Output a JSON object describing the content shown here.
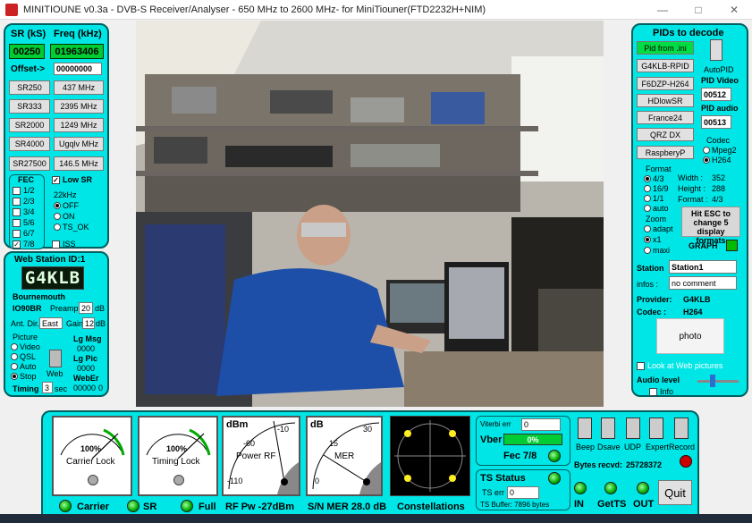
{
  "window": {
    "title": "MINITIOUNE v0.3a - DVB-S Receiver/Analyser - 650 MHz to 2600 MHz- for MiniTiouner(FTD2232H+NIM)",
    "min": "—",
    "max": "□",
    "close": "✕"
  },
  "left": {
    "sr_label": "SR (kS)",
    "freq_label": "Freq (kHz)",
    "sr_value": "00250",
    "freq_value": "01963406",
    "offset_label": "Offset->",
    "offset_value": "00000000",
    "sr_buttons": [
      "SR250",
      "SR333",
      "SR2000",
      "SR4000",
      "SR27500"
    ],
    "freq_buttons": [
      "437 MHz",
      "2395 MHz",
      "1249 MHz",
      "Ugqlv MHz",
      "146.5 MHz"
    ],
    "fec_title": "FEC",
    "fec_options": [
      "1/2",
      "2/3",
      "3/4",
      "5/6",
      "6/7",
      "7/8"
    ],
    "low_sr": "Low SR",
    "khz_label": "22kHz",
    "khz_options": [
      "OFF",
      "ON",
      "TS_OK"
    ],
    "iss": "ISS"
  },
  "webstation": {
    "title": "Web Station ID:1",
    "callsign": "G4KLB",
    "location": "Bournemouth",
    "locator": "IO90BR",
    "preamp_label": "Preamp",
    "preamp_value": "20",
    "db": "dB",
    "ant_label": "Ant. Dir.",
    "ant_value": "East",
    "gain_label": "Gain",
    "gain_value": "12",
    "picture_label": "Picture",
    "picture_options": [
      "Video",
      "QSL",
      "Auto",
      "Stop"
    ],
    "web": "Web",
    "lgmsg_label": "Lg Msg",
    "lgmsg_value": "0000",
    "lgpic_label": "Lg Pic",
    "lgpic_value": "0000",
    "weberr_label": "WebEr",
    "weberr_value": "00000",
    "weberr_suffix": "0",
    "timing_label": "Timing",
    "timing_value": "3",
    "sec": "sec"
  },
  "right": {
    "title": "PIDs to decode",
    "pid_buttons": [
      "Pid from .ini",
      "G4KLB-RPID",
      "F6DZP-H264",
      "HDlowSR",
      "France24",
      "QRZ DX",
      "RaspberyP"
    ],
    "autopid": "AutoPID",
    "pid_video_label": "PID Video",
    "pid_video_value": "00512",
    "pid_audio_label": "PID audio",
    "pid_audio_value": "00513",
    "codec_label": "Codec",
    "codec_options": [
      "Mpeg2",
      "H264"
    ],
    "format_label": "Format",
    "format_options": [
      "4/3",
      "16/9",
      "1/1",
      "auto"
    ],
    "width_label": "Width :",
    "width_value": "352",
    "height_label": "Height :",
    "height_value": "288",
    "fmt_label": "Format :",
    "fmt_value": "4/3",
    "zoom_label": "Zoom",
    "zoom_options": [
      "adapt",
      "x1",
      "maxi"
    ],
    "esc_text": "Hit ESC to change 5 display formats",
    "graph": "GRAPH",
    "station_label": "Station",
    "station_value": "Station1",
    "infos_label": "infos :",
    "infos_value": "no comment",
    "provider_label": "Provider:",
    "provider_value": "G4KLB",
    "codec2_label": "Codec :",
    "codec2_value": "H264",
    "photo": "photo",
    "look_web": "Look at Web pictures",
    "audio_label": "Audio level",
    "info": "Info"
  },
  "bottom": {
    "carrier_pct": "100%",
    "carrier_lock": "Carrier Lock",
    "timing_pct": "100%",
    "timing_lock": "Timing Lock",
    "power_unit": "dBm",
    "power_ticks": [
      "-60",
      "-10",
      "-110"
    ],
    "power_label": "Power RF",
    "mer_unit": "dB",
    "mer_ticks": [
      "15",
      "30",
      "0"
    ],
    "mer_label": "MER",
    "led_carrier": "Carrier",
    "led_sr": "SR",
    "led_full": "Full",
    "rf_pw": "RF Pw -27dBm",
    "sn_mer": "S/N MER  28.0 dB",
    "constellations": "Constellations",
    "viterbi_label": "Viterbi err",
    "viterbi_value": "0",
    "vber_label": "Vber",
    "vber_value": "0%",
    "fec_label": "Fec 7/8",
    "ts_status": "TS Status",
    "ts_err_label": "TS err",
    "ts_err_value": "0",
    "ts_buffer": "TS Buffer: 7896 bytes",
    "switches": [
      "Beep",
      "Dsave",
      "UDP",
      "Expert",
      "Record"
    ],
    "bytes_label": "Bytes recvd:",
    "bytes_value": "25728372",
    "in": "IN",
    "getts": "GetTS",
    "out": "OUT",
    "quit": "Quit"
  },
  "colors": {
    "panel": "#00e6e6",
    "panel_border": "#006060",
    "led_green": "#00aa00",
    "vber_bar": "#00cc33"
  }
}
